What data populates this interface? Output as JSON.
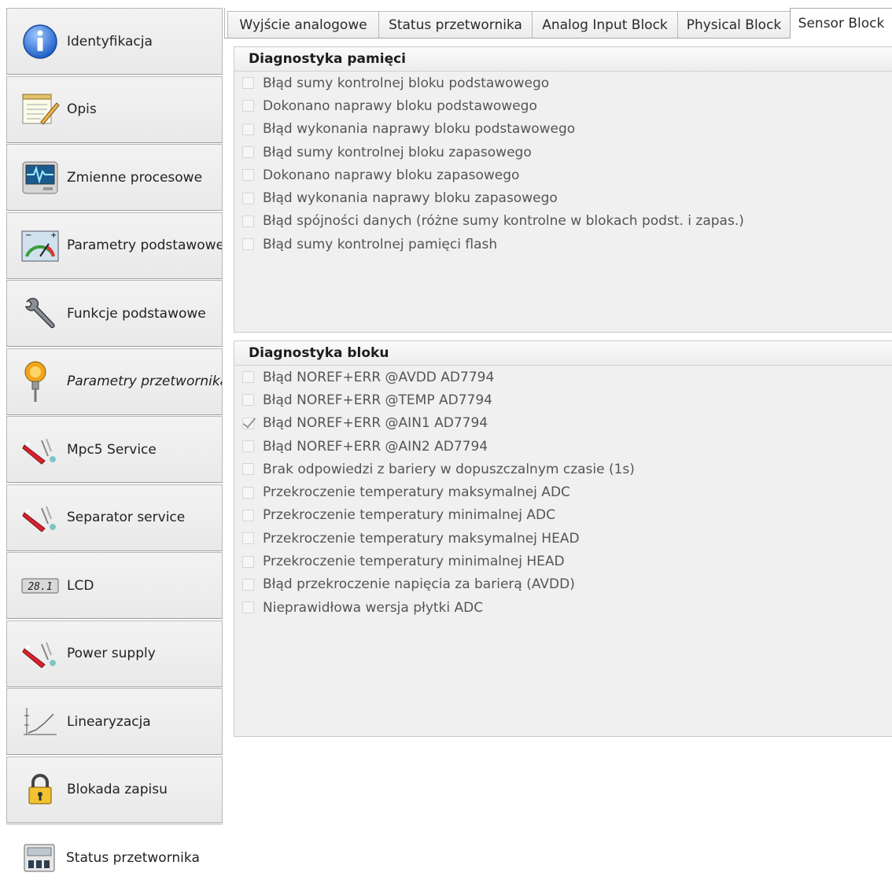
{
  "sidebar": {
    "items": [
      {
        "label": "Identyfikacja",
        "icon": "info-icon",
        "italic": false,
        "active": false
      },
      {
        "label": "Opis",
        "icon": "notepad-icon",
        "italic": false,
        "active": false
      },
      {
        "label": "Zmienne procesowe",
        "icon": "monitor-icon",
        "italic": false,
        "active": false
      },
      {
        "label": "Parametry podstawowe",
        "icon": "gauge-icon",
        "italic": false,
        "active": false
      },
      {
        "label": "Funkcje podstawowe",
        "icon": "wrench-icon",
        "italic": false,
        "active": false
      },
      {
        "label": "Parametry przetwornika",
        "icon": "transmitter-icon",
        "italic": true,
        "active": false
      },
      {
        "label": "Mpc5 Service",
        "icon": "service-tool-icon",
        "italic": false,
        "active": false
      },
      {
        "label": "Separator service",
        "icon": "service-tool-icon",
        "italic": false,
        "active": false
      },
      {
        "label": "LCD",
        "icon": "lcd-icon",
        "italic": false,
        "active": false,
        "lcd_text": "28.1"
      },
      {
        "label": "Power supply",
        "icon": "service-tool-icon",
        "italic": false,
        "active": false
      },
      {
        "label": "Linearyzacja",
        "icon": "line-chart-icon",
        "italic": false,
        "active": false
      },
      {
        "label": "Blokada zapisu",
        "icon": "padlock-icon",
        "italic": false,
        "active": false
      },
      {
        "label": "Status przetwornika",
        "icon": "status-panel-icon",
        "italic": false,
        "active": true
      }
    ]
  },
  "tabs": [
    {
      "label": "Wyjście analogowe",
      "active": false
    },
    {
      "label": "Status przetwornika",
      "active": false
    },
    {
      "label": "Analog Input Block",
      "active": false
    },
    {
      "label": "Physical Block",
      "active": false
    },
    {
      "label": "Sensor Block",
      "active": true
    }
  ],
  "groups": {
    "memory": {
      "title": "Diagnostyka pamięci",
      "items": [
        {
          "label": "Błąd sumy kontrolnej bloku podstawowego",
          "checked": false
        },
        {
          "label": "Dokonano naprawy bloku podstawowego",
          "checked": false
        },
        {
          "label": "Błąd wykonania naprawy bloku podstawowego",
          "checked": false
        },
        {
          "label": "Błąd sumy kontrolnej bloku zapasowego",
          "checked": false
        },
        {
          "label": "Dokonano naprawy bloku zapasowego",
          "checked": false
        },
        {
          "label": "Błąd wykonania naprawy bloku zapasowego",
          "checked": false
        },
        {
          "label": "Błąd spójności danych (różne sumy kontrolne w blokach podst. i zapas.)",
          "checked": false
        },
        {
          "label": "Błąd sumy kontrolnej pamięci flash",
          "checked": false
        }
      ]
    },
    "block": {
      "title": "Diagnostyka bloku",
      "items": [
        {
          "label": "Błąd NOREF+ERR @AVDD AD7794",
          "checked": false
        },
        {
          "label": "Błąd NOREF+ERR @TEMP AD7794",
          "checked": false
        },
        {
          "label": "Błąd NOREF+ERR @AIN1 AD7794",
          "checked": true
        },
        {
          "label": "Błąd NOREF+ERR @AIN2 AD7794",
          "checked": false
        },
        {
          "label": "Brak odpowiedzi z bariery w dopuszczalnym czasie (1s)",
          "checked": false
        },
        {
          "label": "Przekroczenie temperatury maksymalnej ADC",
          "checked": false
        },
        {
          "label": "Przekroczenie temperatury minimalnej ADC",
          "checked": false
        },
        {
          "label": "Przekroczenie temperatury maksymalnej HEAD",
          "checked": false
        },
        {
          "label": "Przekroczenie temperatury minimalnej HEAD",
          "checked": false
        },
        {
          "label": "Błąd przekroczenie napięcia za barierą (AVDD)",
          "checked": false
        },
        {
          "label": "Nieprawidłowa wersja płytki ADC",
          "checked": false
        }
      ]
    }
  }
}
